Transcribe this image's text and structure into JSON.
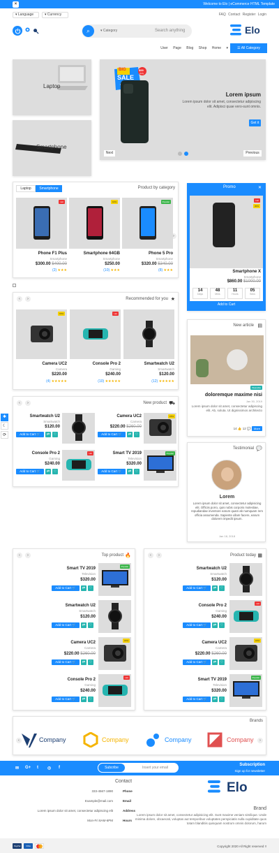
{
  "topbar": {
    "close": "×",
    "welcome": "Welcome to Elo | eCommerce HTML Template"
  },
  "header": {
    "language": "Language",
    "currency": "Currency",
    "links": "FAQ   Contact   Register   Login",
    "search_category": "Category",
    "search_placeholder": "Search anything",
    "logo": "Elo",
    "menu": [
      "User",
      "Page",
      "Blog",
      "Shop",
      "Home"
    ],
    "all_category": "All Category"
  },
  "hero": {
    "cat1": "Laptop",
    "cat2": "Smartphone",
    "badge_big": "BIG",
    "badge_sale": "SALE",
    "badge_price": "$99",
    "badge_only": "Only",
    "badge_small": "Grab offer",
    "title": "Lorem ipsum",
    "text": "Lorem ipsum dolor sit amet, consectetur adipiscing elit. Adipisci quae vero-sunt omnis.",
    "cta": "Get it",
    "next": "Next",
    "previous": "Previous"
  },
  "by_category": {
    "tabs": [
      "Laptop",
      "Smartphone"
    ],
    "title": "Product by category",
    "products": [
      {
        "name": "Phone F1 Plus",
        "cat": "Smartphone",
        "price": "$300.00",
        "old": "$400.00",
        "rating": "(2)",
        "tag": "Hot"
      },
      {
        "name": "Smartphone 64GB",
        "cat": "Smartphone",
        "price": "$250.00",
        "old": "",
        "rating": "(10)",
        "tag": "10%"
      },
      {
        "name": "Phone 5 Pro",
        "cat": "Smartphone",
        "price": "$320.00",
        "old": "$340.00",
        "rating": "(8)",
        "tag": "Popular"
      }
    ]
  },
  "promo": {
    "title": "Promo",
    "name": "Smartphone X",
    "cat": "Smartphone",
    "price": "$860.00",
    "old": "$1000.00",
    "tag1": "Hot",
    "tag2": "30%",
    "countdown": [
      {
        "v": "14",
        "l": "Days"
      },
      {
        "v": "48",
        "l": "Mins"
      },
      {
        "v": "11",
        "l": "Hours"
      },
      {
        "v": "05",
        "l": "Secs"
      }
    ],
    "add": "Add to Cart"
  },
  "recommended": {
    "title": "Recommended for you",
    "products": [
      {
        "name": "Camera UC2",
        "cat": "Camera",
        "price": "$220.00",
        "rating": "(4)",
        "tag": "15%"
      },
      {
        "name": "Console Pro 2",
        "cat": "Gaming",
        "price": "$240.00",
        "rating": "(10)",
        "tag": "Hot"
      },
      {
        "name": "Smartwatch U2",
        "cat": "Smartwatch",
        "price": "$120.00",
        "rating": "(12)",
        "tag": ""
      }
    ]
  },
  "new_article": {
    "title": "New article",
    "tag": "Wearable",
    "headline": "doloremque maxime nisi",
    "date": "Jan 30, 2019",
    "text": "Lorem ipsum dolor sit amet, consectetur adipiscing elit. Ab, soluta. Ut dignissimos architecto",
    "likes": "14",
    "comments": "12",
    "more": "More"
  },
  "new_product": {
    "title": "New product",
    "products": [
      {
        "name": "Smartwatch U2",
        "cat": "Smartwatch",
        "price": "$120.00",
        "old": "",
        "tag": ""
      },
      {
        "name": "Camera UC2",
        "cat": "Camera",
        "price": "$220.00",
        "old": "$260.00",
        "tag": "15%"
      },
      {
        "name": "Console Pro 2",
        "cat": "Gaming",
        "price": "$240.00",
        "old": "",
        "tag": "Hot"
      },
      {
        "name": "Smart TV 2019",
        "cat": "Television",
        "price": "$320.00",
        "old": "",
        "tag": "Popular"
      }
    ],
    "add": "Add to Cart"
  },
  "testimonial": {
    "title": "Testimonial",
    "name": "Lorem",
    "text": "Lorem ipsum dolor sit amet, consectetur adipisicing elit. Officiis porro, quis nobis corporis molestiae, repudiandae inventore earum quam ab numquam rem officia assumenda. Sapiente ullam facere, earum dolorem impedit ipsum.",
    "date": "Jan 18, 2018"
  },
  "top_product": {
    "title": "Top product",
    "products": [
      {
        "name": "Smart TV 2019",
        "cat": "Television",
        "price": "$320.00",
        "old": "",
        "tag": "Popular"
      },
      {
        "name": "Smartwatch U2",
        "cat": "Smartwatch",
        "price": "$120.00",
        "old": "",
        "tag": ""
      },
      {
        "name": "Camera UC2",
        "cat": "Camera",
        "price": "$220.00",
        "old": "$260.00",
        "tag": "15%"
      },
      {
        "name": "Console Pro 2",
        "cat": "Gaming",
        "price": "$240.00",
        "old": "",
        "tag": "Hot"
      }
    ]
  },
  "product_today": {
    "title": "Product today",
    "products": [
      {
        "name": "Smartwatch U2",
        "cat": "Smartwatch",
        "price": "$120.00",
        "old": "",
        "tag": ""
      },
      {
        "name": "Console Pro 2",
        "cat": "Gaming",
        "price": "$240.00",
        "old": "",
        "tag": "Hot"
      },
      {
        "name": "Camera UC2",
        "cat": "Camera",
        "price": "$220.00",
        "old": "$260.00",
        "tag": "15%"
      },
      {
        "name": "Smart TV 2019",
        "cat": "Television",
        "price": "$320.00",
        "old": "",
        "tag": "Popular"
      }
    ]
  },
  "brands": {
    "title": "Brands",
    "items": [
      "Company",
      "Company",
      "Company",
      "Company"
    ]
  },
  "footer": {
    "subscribe_btn": "Subcribe",
    "email_placeholder": "Insert your email",
    "subscription_title": "Subscription",
    "subscription_sub": "Sign up for newsletter",
    "contact_title": "Contact",
    "contact": [
      {
        "v": "333-4567-1890",
        "k": "Phone"
      },
      {
        "v": "Example@mail.com",
        "k": "Email"
      },
      {
        "v": "Lorem ipsum dolor sit amet, consectetur adipiscing elit",
        "k": "Address"
      },
      {
        "v": "Mon-Fri 8AM-6PM",
        "k": "Hours"
      }
    ],
    "brand_title": "Brand",
    "brand_text": "Lorem ipsum dolor sit amet, consectetur adipisicing elit. Sunt maxime veniam similique. Unde minima dolore, obcaecati, voluptas aut temporibus voluptates perspiciatis nulla cupiditate quos totam blanditiis quisquam nostrum omnis dolorum, harum",
    "copyright": "Copyright 2020 All Right reserved !!",
    "payments": [
      "PayPal",
      "VISA",
      ""
    ],
    "logo": "Elo"
  },
  "colors": {
    "accent": "#1a8cff",
    "navy": "#1d3f72",
    "hot": "#e33333",
    "popular": "#3bb54a",
    "teal": "#26b5b0",
    "star": "#f5b400"
  }
}
